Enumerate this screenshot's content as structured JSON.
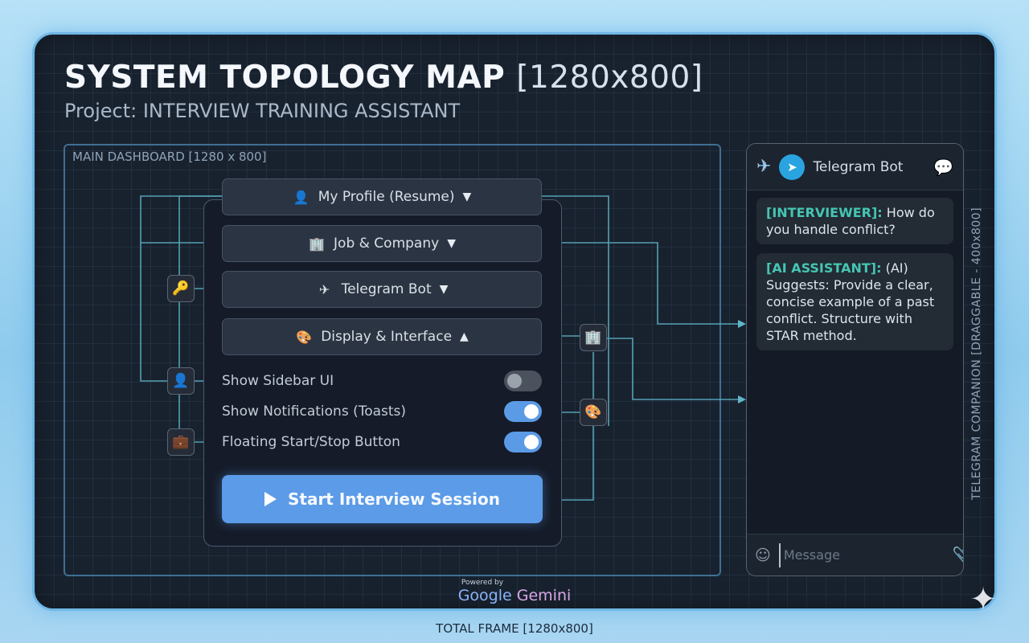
{
  "title": {
    "main": "SYSTEM TOPOLOGY MAP",
    "size": "[1280x800]"
  },
  "subtitle": "Project: INTERVIEW TRAINING ASSISTANT",
  "dashboard": {
    "label": "MAIN DASHBOARD [1280 x 800]",
    "sections": [
      {
        "label": "My Profile (Resume)",
        "icon": "person-icon",
        "arrow": "▼"
      },
      {
        "label": "Job & Company",
        "icon": "building-icon",
        "arrow": "▼"
      },
      {
        "label": "Telegram Bot",
        "icon": "plane-icon",
        "arrow": "▼"
      },
      {
        "label": "Display & Interface",
        "icon": "palette-icon",
        "arrow": "▲"
      }
    ],
    "toggles": [
      {
        "label": "Show Sidebar UI",
        "state": "off"
      },
      {
        "label": "Show Notifications (Toasts)",
        "state": "on"
      },
      {
        "label": "Floating Start/Stop Button",
        "state": "on"
      }
    ],
    "start_button": "Start Interview Session"
  },
  "nodes": [
    "key-icon",
    "person-icon",
    "briefcase-icon",
    "building-icon",
    "palette-icon"
  ],
  "telegram": {
    "header": "Telegram Bot",
    "messages": [
      {
        "who": "[INTERVIEWER]:",
        "text": " How do you handle conflict?"
      },
      {
        "who": "[AI ASSISTANT]:",
        "text": " (AI) Suggests: Provide a clear, concise example of a past conflict. Structure with STAR method."
      }
    ],
    "input_placeholder": "Message",
    "side_label": "TELEGRAM COMPANION [DRAGGABLE - 400x800]"
  },
  "powered": {
    "small": "Powered by",
    "google": "Google",
    "gemini": "Gemini"
  },
  "footer": "TOTAL FRAME [1280x800]",
  "colors": {
    "accent": "#5b9be8",
    "connector": "#5fb7c9",
    "speaker": "#45c6b4",
    "frame_border": "#6fb8e6"
  }
}
